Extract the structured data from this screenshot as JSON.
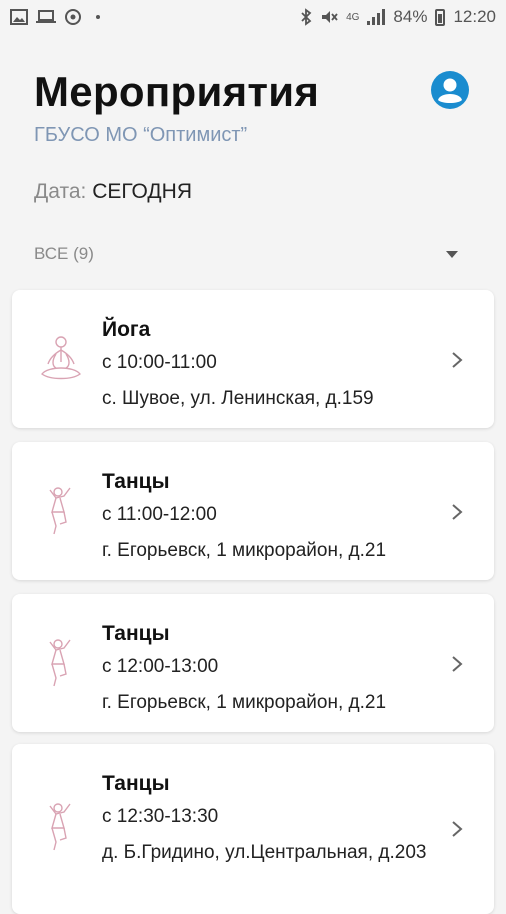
{
  "status_bar": {
    "battery": "84%",
    "time": "12:20",
    "network": "4G"
  },
  "header": {
    "title": "Мероприятия",
    "organization": "ГБУСО МО “Оптимист”"
  },
  "date": {
    "label": "Дата:",
    "value": "СЕГОДНЯ"
  },
  "filter": {
    "label": "ВСЕ (9)"
  },
  "events": [
    {
      "name": "Йога",
      "time": "с 10:00-11:00",
      "address": "с. Шувое, ул. Ленинская, д.159",
      "icon": "yoga-icon"
    },
    {
      "name": "Танцы",
      "time": "с 11:00-12:00",
      "address": "г. Егорьевск, 1 микрорайон, д.21",
      "icon": "dance-icon"
    },
    {
      "name": "Танцы",
      "time": "с 12:00-13:00",
      "address": "г. Егорьевск, 1 микрорайон, д.21",
      "icon": "dance-icon"
    },
    {
      "name": "Танцы",
      "time": "с 12:30-13:30",
      "address": "д. Б.Гридино, ул.Центральная, д.203",
      "icon": "dance-icon"
    }
  ],
  "colors": {
    "accent": "#1a8ccf",
    "icon_line": "#d9a3b3",
    "subtitle": "#7f96b4"
  }
}
